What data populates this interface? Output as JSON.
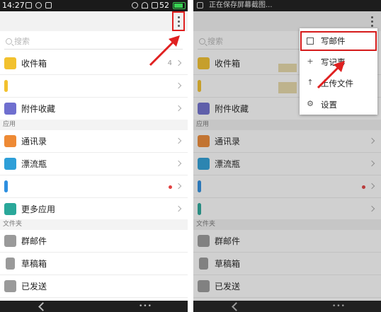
{
  "left": {
    "status": {
      "time": "14:27",
      "signal": "52"
    },
    "search_placeholder": "搜索",
    "inbox": {
      "label": "收件箱",
      "count": "4"
    },
    "favorites_label": "附件收藏",
    "apps_header": "应用",
    "contacts_label": "通讯录",
    "bottle_label": "漂流瓶",
    "more_apps_label": "更多应用",
    "folders_header": "文件夹",
    "group_mail_label": "群邮件",
    "drafts_label": "草稿箱",
    "sent_label": "已发送"
  },
  "right": {
    "status_notice": "正在保存屏幕截图...",
    "search_placeholder": "搜索",
    "inbox_label": "收件箱",
    "favorites_label": "附件收藏",
    "apps_header": "应用",
    "contacts_label": "通讯录",
    "bottle_label": "漂流瓶",
    "folders_header": "文件夹",
    "group_mail_label": "群邮件",
    "drafts_label": "草稿箱",
    "sent_label": "已发送",
    "menu": {
      "compose": "写邮件",
      "note": "写记事",
      "upload": "上传文件",
      "settings": "设置"
    }
  },
  "colors": {
    "inbox": "#f2c12e",
    "favorites": "#6f6fcf",
    "contacts": "#ee8a35",
    "bottle": "#2e9fd8",
    "blue_app": "#2d8fe0",
    "more_apps": "#2aa89a",
    "folder": "#9a9a9a",
    "highlight": "#e02020"
  },
  "icons": {
    "more": "more-vertical-icon",
    "compose": "pencil-square-icon",
    "note": "plus-icon",
    "upload": "upload-arrow-icon",
    "settings": "gear-icon"
  }
}
